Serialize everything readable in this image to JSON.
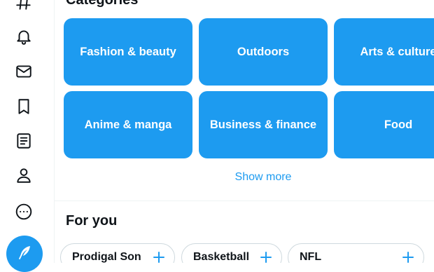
{
  "nav": {
    "icons": [
      "hashtag-icon",
      "bell-icon",
      "mail-icon",
      "bookmark-icon",
      "list-icon",
      "profile-icon",
      "more-icon"
    ],
    "compose_icon": "feather-icon"
  },
  "categories": {
    "title": "Categories",
    "tiles": [
      "Fashion & beauty",
      "Outdoors",
      "Arts & culture",
      "Anime & manga",
      "Business & finance",
      "Food"
    ],
    "show_more": "Show more"
  },
  "for_you": {
    "title": "For you",
    "chips": [
      "Prodigal Son",
      "Basketball",
      "NFL"
    ]
  },
  "colors": {
    "accent": "#1d9bf0",
    "text": "#0f1419",
    "border": "#cfd9de"
  }
}
